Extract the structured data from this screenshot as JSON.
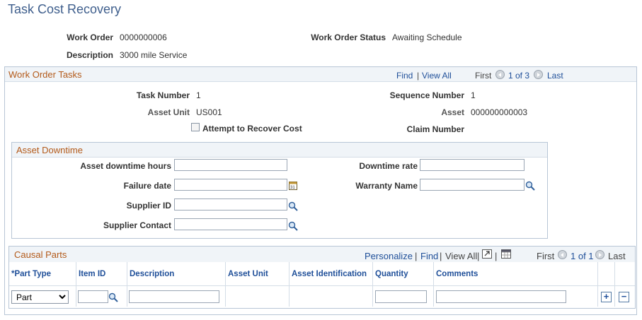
{
  "page_title": "Task Cost Recovery",
  "header": {
    "work_order_label": "Work Order",
    "work_order_value": "0000000006",
    "status_label": "Work Order Status",
    "status_value": "Awaiting Schedule",
    "description_label": "Description",
    "description_value": "3000 mile Service"
  },
  "tasks": {
    "title": "Work Order Tasks",
    "nav": {
      "find": "Find",
      "sep": "|",
      "view_all": "View All",
      "first": "First",
      "range": "1 of 3",
      "last": "Last"
    },
    "task_number_label": "Task Number",
    "task_number_value": "1",
    "sequence_number_label": "Sequence Number",
    "sequence_number_value": "1",
    "asset_unit_label": "Asset Unit",
    "asset_unit_value": "US001",
    "asset_label": "Asset",
    "asset_value": "000000000003",
    "attempt_label": "Attempt to Recover Cost",
    "claim_number_label": "Claim Number"
  },
  "downtime": {
    "title": "Asset Downtime",
    "hours_label": "Asset downtime hours",
    "rate_label": "Downtime rate",
    "failure_date_label": "Failure date",
    "warranty_name_label": "Warranty Name",
    "supplier_id_label": "Supplier ID",
    "supplier_contact_label": "Supplier Contact",
    "calendar_glyph": "31"
  },
  "causal_parts": {
    "title": "Causal Parts",
    "nav": {
      "personalize": "Personalize",
      "find": "Find",
      "view_all": "View All",
      "first": "First",
      "range": "1 of 1",
      "last": "Last"
    },
    "columns": [
      "*Part Type",
      "Item ID",
      "Description",
      "Asset Unit",
      "Asset Identification",
      "Quantity",
      "Comments"
    ],
    "row": {
      "part_type": "Part"
    }
  },
  "icons": {
    "lookup": "magnifier-icon",
    "calendar": "calendar-icon",
    "add": "+",
    "remove": "−"
  }
}
